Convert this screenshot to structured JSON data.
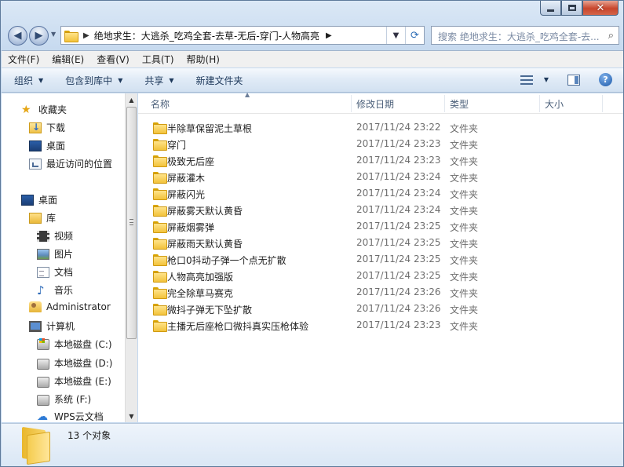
{
  "window": {
    "caption_buttons": {
      "minimize": "–",
      "maximize": "□",
      "close": "✕"
    }
  },
  "address": {
    "path": "绝地求生：大逃杀_吃鸡全套-去草-无后-穿门-人物高亮",
    "search_placeholder": "搜索 绝地求生：大逃杀_吃鸡全套-去..."
  },
  "menu": [
    "文件(F)",
    "编辑(E)",
    "查看(V)",
    "工具(T)",
    "帮助(H)"
  ],
  "toolbar": {
    "organize": "组织",
    "include_library": "包含到库中",
    "share": "共享",
    "new_folder": "新建文件夹"
  },
  "nav": {
    "favorites": "收藏夹",
    "downloads": "下载",
    "desktop_fav": "桌面",
    "recent": "最近访问的位置",
    "desktop": "桌面",
    "libraries": "库",
    "videos": "视频",
    "pictures": "图片",
    "documents": "文档",
    "music": "音乐",
    "admin": "Administrator",
    "computer": "计算机",
    "drive_c": "本地磁盘 (C:)",
    "drive_d": "本地磁盘 (D:)",
    "drive_e": "本地磁盘 (E:)",
    "drive_f": "系统 (F:)",
    "wps": "WPS云文档"
  },
  "columns": {
    "name": "名称",
    "date": "修改日期",
    "type": "类型",
    "size": "大小"
  },
  "files": [
    {
      "name": "半除草保留泥土草根",
      "date": "2017/11/24 23:22",
      "type": "文件夹"
    },
    {
      "name": "穿门",
      "date": "2017/11/24 23:23",
      "type": "文件夹"
    },
    {
      "name": "极致无后座",
      "date": "2017/11/24 23:23",
      "type": "文件夹"
    },
    {
      "name": "屏蔽灌木",
      "date": "2017/11/24 23:24",
      "type": "文件夹"
    },
    {
      "name": "屏蔽闪光",
      "date": "2017/11/24 23:24",
      "type": "文件夹"
    },
    {
      "name": "屏蔽雾天默认黄昏",
      "date": "2017/11/24 23:24",
      "type": "文件夹"
    },
    {
      "name": "屏蔽烟雾弹",
      "date": "2017/11/24 23:25",
      "type": "文件夹"
    },
    {
      "name": "屏蔽雨天默认黄昏",
      "date": "2017/11/24 23:25",
      "type": "文件夹"
    },
    {
      "name": "枪口0抖动子弹一个点无扩散",
      "date": "2017/11/24 23:25",
      "type": "文件夹"
    },
    {
      "name": "人物高亮加强版",
      "date": "2017/11/24 23:25",
      "type": "文件夹"
    },
    {
      "name": "完全除草马赛克",
      "date": "2017/11/24 23:26",
      "type": "文件夹"
    },
    {
      "name": "微抖子弹无下坠扩散",
      "date": "2017/11/24 23:26",
      "type": "文件夹"
    },
    {
      "name": "主播无后座枪口微抖真实压枪体验",
      "date": "2017/11/24 23:23",
      "type": "文件夹"
    }
  ],
  "status": {
    "count_text": "13 个对象"
  }
}
